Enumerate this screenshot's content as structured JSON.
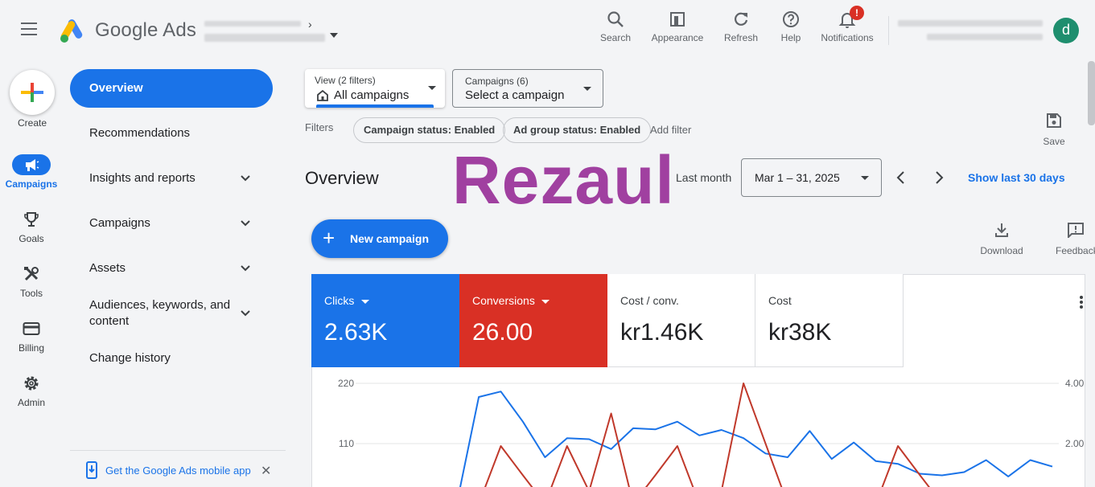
{
  "header": {
    "brand": "Google Ads",
    "buttons": [
      {
        "label": "Search",
        "icon": "search-icon"
      },
      {
        "label": "Appearance",
        "icon": "appearance-icon"
      },
      {
        "label": "Refresh",
        "icon": "refresh-icon"
      },
      {
        "label": "Help",
        "icon": "help-icon"
      },
      {
        "label": "Notifications",
        "icon": "bell-icon"
      }
    ],
    "notification_badge": "!",
    "avatar_letter": "d"
  },
  "rail": {
    "create": "Create",
    "items": [
      {
        "label": "Campaigns",
        "icon": "megaphone-icon",
        "active": true
      },
      {
        "label": "Goals",
        "icon": "trophy-icon"
      },
      {
        "label": "Tools",
        "icon": "tools-icon"
      },
      {
        "label": "Billing",
        "icon": "credit-card-icon"
      },
      {
        "label": "Admin",
        "icon": "gear-icon"
      }
    ]
  },
  "nav": {
    "active": "Overview",
    "items": [
      {
        "label": "Recommendations"
      },
      {
        "label": "Insights and reports"
      },
      {
        "label": "Campaigns"
      },
      {
        "label": "Assets"
      },
      {
        "label": "Audiences, keywords, and content"
      },
      {
        "label": "Change history"
      }
    ],
    "mobile_app": "Get the Google Ads mobile app"
  },
  "toolbar": {
    "view_small": "View (2 filters)",
    "view_value": "All campaigns",
    "campaigns_small": "Campaigns (6)",
    "campaigns_value": "Select a campaign",
    "filters_label": "Filters",
    "chips": [
      "Campaign status: Enabled",
      "Ad group status: Enabled"
    ],
    "add_filter": "Add filter",
    "save": "Save"
  },
  "main": {
    "title": "Overview",
    "watermark": "Rezaul",
    "last_month": "Last month",
    "date_range": "Mar 1 – 31, 2025",
    "show_last": "Show last 30 days",
    "new_campaign": "New campaign",
    "download": "Download",
    "feedback": "Feedback"
  },
  "scorecards": [
    {
      "name": "Clicks",
      "value": "2.63K",
      "color": "#1a73e8"
    },
    {
      "name": "Conversions",
      "value": "26.00",
      "color": "#d93025"
    },
    {
      "name": "Cost / conv.",
      "value": "kr1.46K"
    },
    {
      "name": "Cost",
      "value": "kr38K"
    }
  ],
  "chart_data": {
    "type": "line",
    "y_left_ticks": [
      "220",
      "110"
    ],
    "y_right_ticks": [
      "4.00",
      "2.00"
    ],
    "y_left_range": [
      0,
      220
    ],
    "y_right_range": [
      0,
      4
    ],
    "series": [
      {
        "color": "#1a73e8",
        "axis": "left",
        "values": [
          null,
          2,
          0,
          0,
          0,
          195,
          205,
          150,
          85,
          120,
          118,
          100,
          138,
          136,
          150,
          125,
          135,
          120,
          92,
          85,
          133,
          82,
          112,
          78,
          73,
          55,
          52,
          58,
          80,
          50,
          80,
          68
        ]
      },
      {
        "color": "#c0392b",
        "axis": "right",
        "values": [
          0.42,
          0.0,
          0.0,
          0.42,
          0.0,
          0.0,
          1.92,
          0.95,
          0.0,
          1.92,
          0.42,
          3.0,
          0.0,
          0.95,
          1.92,
          0.0,
          0.42,
          4.0,
          2.0,
          0.0,
          0.0,
          0.42,
          0.0,
          0.0,
          1.92,
          0.95,
          0.0,
          0.0,
          0.0,
          0.42,
          0.0,
          0.0
        ]
      }
    ]
  }
}
